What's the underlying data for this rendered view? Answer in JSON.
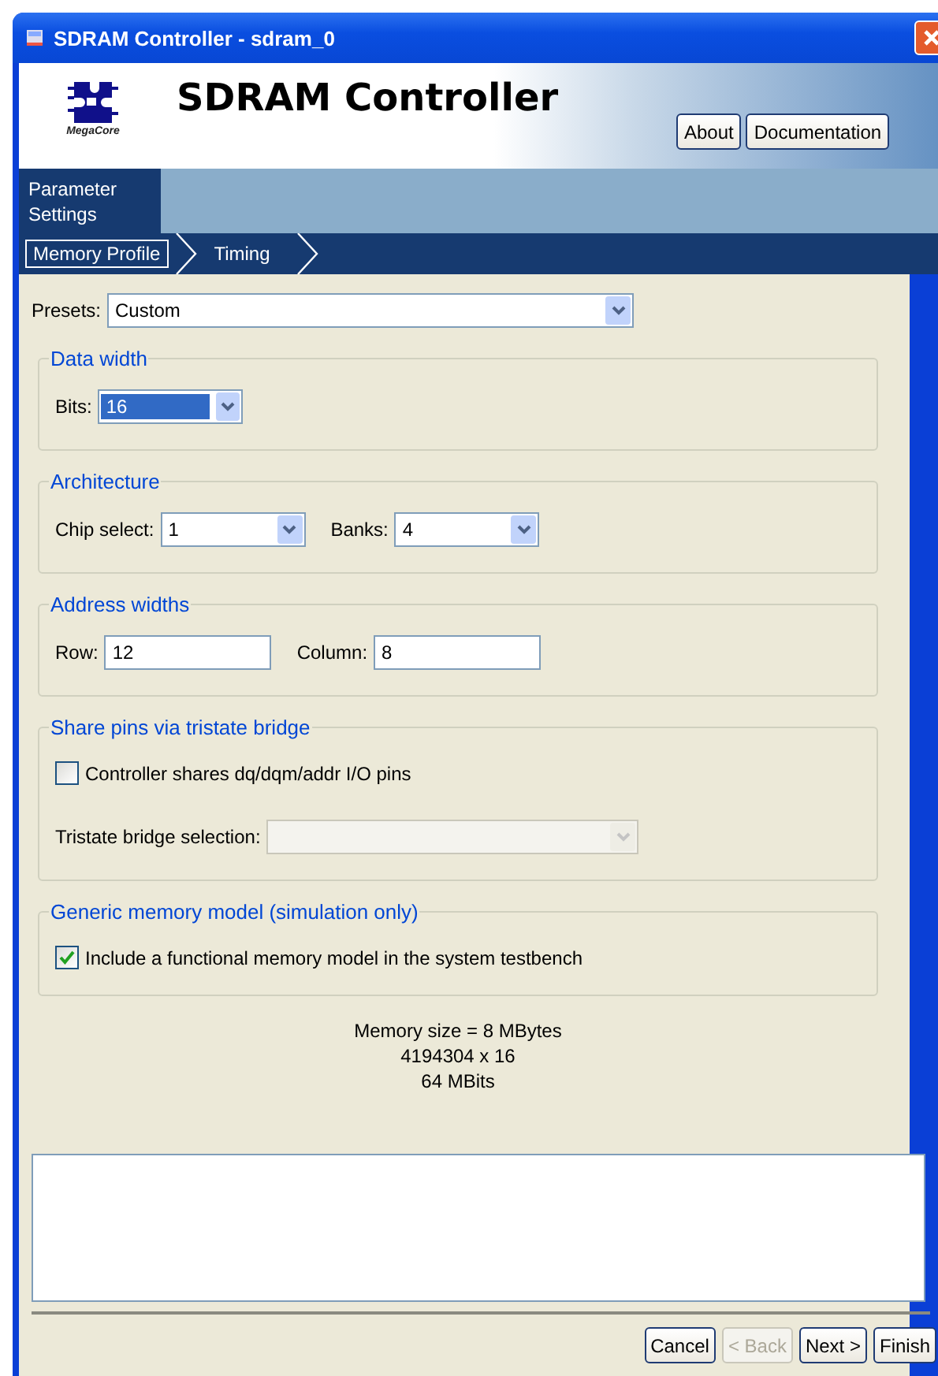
{
  "window": {
    "title": "SDRAM Controller - sdram_0"
  },
  "header": {
    "logo_caption": "MegaCore",
    "title": "SDRAM Controller",
    "buttons": [
      {
        "label": "About"
      },
      {
        "label": "Documentation"
      }
    ]
  },
  "tabs": [
    {
      "label": "Parameter Settings",
      "selected": true
    }
  ],
  "subtabs": [
    {
      "label": "Memory Profile",
      "selected": true
    },
    {
      "label": "Timing",
      "selected": false
    }
  ],
  "presets": {
    "label": "Presets:",
    "value": "Custom"
  },
  "groups": [
    {
      "title": "Data width",
      "fields": [
        {
          "kind": "dropdown",
          "label": "Bits:",
          "value": "16",
          "highlighted": true,
          "disabled": false
        }
      ]
    },
    {
      "title": "Architecture",
      "fields": [
        {
          "kind": "dropdown",
          "label": "Chip select:",
          "value": "1",
          "disabled": false
        },
        {
          "kind": "dropdown",
          "label": "Banks:",
          "value": "4",
          "disabled": false
        }
      ]
    },
    {
      "title": "Address widths",
      "fields": [
        {
          "kind": "text",
          "label": "Row:",
          "value": "12"
        },
        {
          "kind": "text",
          "label": "Column:",
          "value": "8"
        }
      ]
    },
    {
      "title": "Share pins via tristate bridge",
      "fields": [
        {
          "kind": "checkbox",
          "label": "Controller shares dq/dqm/addr I/O pins",
          "checked": false
        },
        {
          "kind": "dropdown",
          "label": "Tristate bridge selection:",
          "disabled": true
        }
      ]
    },
    {
      "title": "Generic memory model (simulation only)",
      "fields": [
        {
          "kind": "checkbox",
          "label": "Include a functional memory model in the system testbench",
          "checked": true
        }
      ]
    }
  ],
  "summary": [
    "Memory size = 8 MBytes",
    "4194304 x 16",
    "64 MBits"
  ],
  "footer_buttons": [
    {
      "label": "Cancel",
      "disabled": false
    },
    {
      "label": "< Back",
      "disabled": true
    },
    {
      "label": "Next >",
      "disabled": false
    },
    {
      "label": "Finish",
      "disabled": false
    }
  ]
}
